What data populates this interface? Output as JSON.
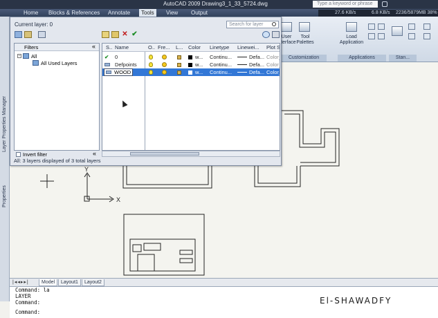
{
  "app": {
    "title": "AutoCAD 2009  Drawing3_1_33_5724.dwg",
    "search_placeholder": "Type a keyword or phrase"
  },
  "menu": [
    {
      "label": "Home",
      "active": false
    },
    {
      "label": "Blocks & References",
      "active": false
    },
    {
      "label": "Annotate",
      "active": false
    },
    {
      "label": "Tools",
      "active": true
    },
    {
      "label": "View",
      "active": false
    },
    {
      "label": "Output",
      "active": false
    }
  ],
  "network": {
    "down": "27.6 KB/s",
    "up": "6.8 KB/s",
    "memory": "2236/5879MB 38%"
  },
  "ribbon": {
    "buttons": [
      {
        "label": "User Interface"
      },
      {
        "label": "Tool Palettes"
      },
      {
        "label": "Load Application"
      },
      {
        "label": ""
      },
      {
        "label": ""
      }
    ],
    "panels": [
      "Customization",
      "Applications",
      "Stan..."
    ]
  },
  "layer_manager": {
    "side_title": "Layer Properties Manager",
    "current_layer": "Current layer: 0",
    "search_placeholder": "Search for layer",
    "filters_title": "Filters",
    "filter_tree": [
      {
        "label": "All",
        "level": 0
      },
      {
        "label": "All Used Layers",
        "level": 1
      }
    ],
    "invert_filter": "Invert filter",
    "collapse_glyph": "«",
    "columns": [
      "S..",
      "Name",
      "O..",
      "Fre...",
      "L...",
      "Color",
      "Linetype",
      "Linewei...",
      "Plot S"
    ],
    "layers": [
      {
        "status": "check",
        "name": "0",
        "color": "w...",
        "linetype": "Continu...",
        "lineweight": "Defa...",
        "plot_style": "Color_",
        "selected": false,
        "editing": false
      },
      {
        "status": "layer",
        "name": "Defpoints",
        "color": "w...",
        "linetype": "Continu...",
        "lineweight": "Defa...",
        "plot_style": "Color_",
        "selected": false,
        "editing": false
      },
      {
        "status": "layer",
        "name": "WOOD",
        "color": "w...",
        "linetype": "Continu...",
        "lineweight": "Defa...",
        "plot_style": "Color_",
        "selected": true,
        "editing": true
      }
    ],
    "status_line": "All: 3 layers displayed of 3 total layers"
  },
  "side_panel_label": "Properties",
  "drawing": {
    "x_axis_label": "X",
    "y_axis_label": "Y"
  },
  "layout_tabs": [
    "Model",
    "Layout1",
    "Layout2"
  ],
  "command_lines": [
    "Command: la",
    "LAYER",
    "Command:",
    "",
    "Command:"
  ],
  "watermark": "El-SHAWADFY"
}
